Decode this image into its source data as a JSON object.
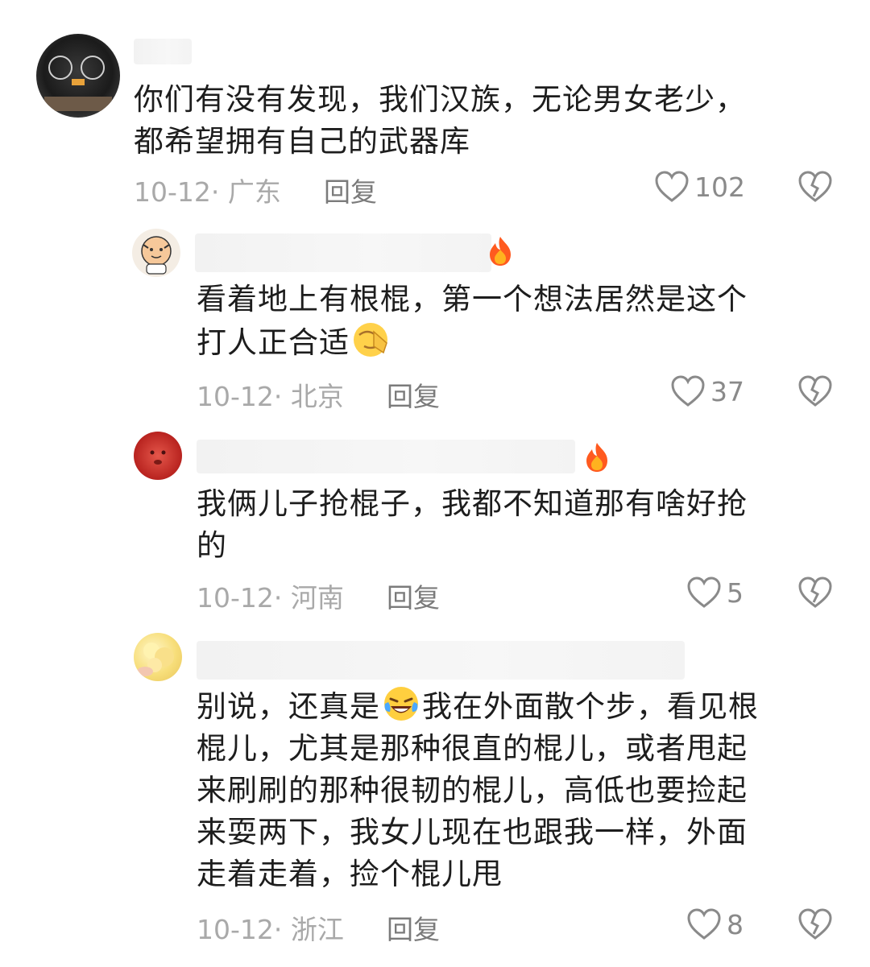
{
  "comments": [
    {
      "text_lines": [
        "你们有没有发现，我们汉族，无论男女老少，",
        "都希望拥有自己的武器库"
      ],
      "date_loc": "10-12· 广东",
      "reply": "回复",
      "likes": "102"
    },
    {
      "text_lines": [
        "看着地上有根棍，第一个想法居然是这个",
        "打人正合适"
      ],
      "date_loc": "10-12· 北京",
      "reply": "回复",
      "likes": "37"
    },
    {
      "text_lines": [
        "我俩儿子抢棍子，我都不知道那有啥好抢",
        "的"
      ],
      "date_loc": "10-12· 河南",
      "reply": "回复",
      "likes": "5"
    },
    {
      "text_lines": [
        "别说，还真是",
        "我在外面散个步，看见根",
        "棍儿，尤其是那种很直的棍儿，或者甩起",
        "来刷刷的那种很韧的棍儿，高低也要捡起",
        "来耍两下，我女儿现在也跟我一样，外面",
        "走着走着，捡个棍儿甩"
      ],
      "date_loc": "10-12· 浙江",
      "reply": "回复",
      "likes": "8"
    }
  ],
  "colors": {
    "text": "#1d1d1d",
    "meta": "#a9a9a9",
    "reply": "#7b7b7b",
    "icon": "#8a8a8a"
  }
}
